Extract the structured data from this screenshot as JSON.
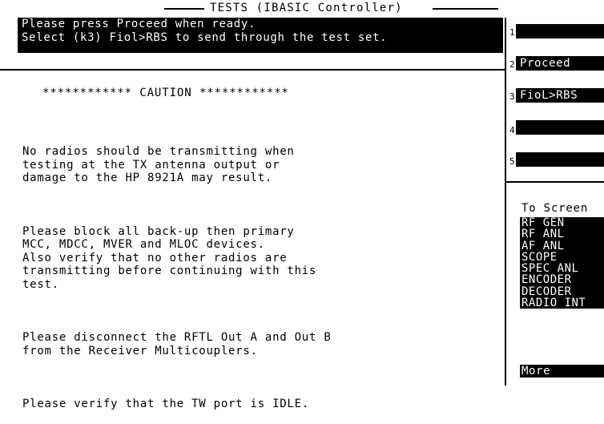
{
  "header": {
    "title": "TESTS (IBASIC Controller)"
  },
  "message_bar": {
    "line1": "Please press Proceed when ready.",
    "line2": "Select (k3) Fiol>RBS to send through the test set."
  },
  "content": {
    "caution": "************ CAUTION ************",
    "paragraphs": [
      "No radios should be transmitting when\ntesting at the TX antenna output or\ndamage to the HP 8921A may result.",
      "Please block all back-up then primary\nMCC, MDCC, MVER and MLOC devices.\nAlso verify that no other radios are\ntransmitting before continuing with this\ntest.",
      "Please disconnect the RFTL Out A and Out B\nfrom the Receiver Multicouplers.",
      "Please verify that the TW port is IDLE."
    ]
  },
  "softkeys": [
    {
      "number": "1",
      "label": ""
    },
    {
      "number": "2",
      "label": "Proceed"
    },
    {
      "number": "3",
      "label": "FioL>RBS"
    },
    {
      "number": "4",
      "label": ""
    },
    {
      "number": "5",
      "label": ""
    }
  ],
  "to_screen": {
    "title": "To Screen",
    "items": [
      "RF GEN",
      "RF ANL",
      "AF ANL",
      "SCOPE",
      "SPEC ANL",
      "ENCODER",
      "DECODER",
      "RADIO INT"
    ],
    "more_label": "More"
  }
}
